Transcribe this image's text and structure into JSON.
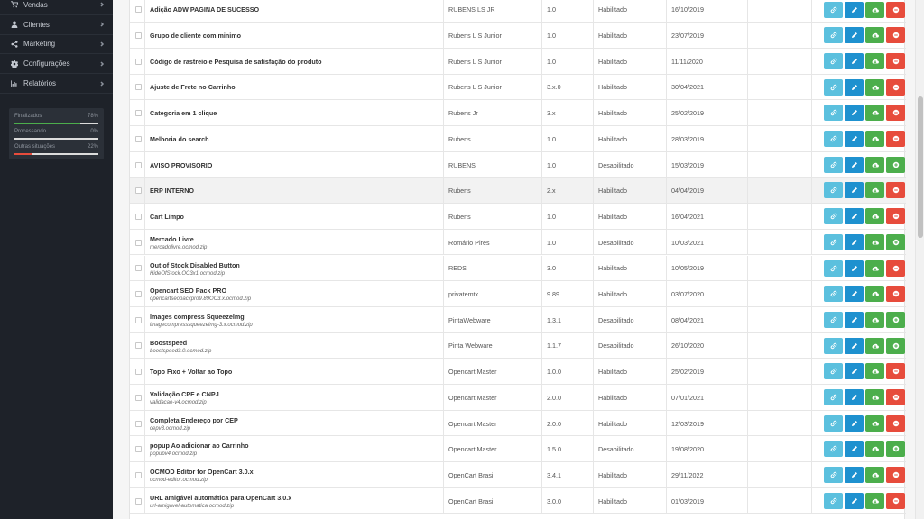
{
  "sidebar": {
    "items": [
      {
        "label": "Vendas",
        "icon": "shopping-cart-icon"
      },
      {
        "label": "Clientes",
        "icon": "user-icon"
      },
      {
        "label": "Marketing",
        "icon": "share-icon"
      },
      {
        "label": "Configurações",
        "icon": "gear-icon"
      },
      {
        "label": "Relatórios",
        "icon": "bar-chart-icon"
      }
    ],
    "stats": [
      {
        "label": "Finalizados",
        "value": "78%",
        "fraction": 0.78,
        "color": "#4cae4c"
      },
      {
        "label": "Processando",
        "value": "0%",
        "fraction": 0.0,
        "color": "#1e91cf"
      },
      {
        "label": "Outras situações",
        "value": "22%",
        "fraction": 0.22,
        "color": "#e74c3c"
      }
    ]
  },
  "colors": {
    "info": "#5bc0de",
    "primary": "#1e91cf",
    "success": "#4cae4c",
    "danger": "#e74c3c"
  },
  "modifications": [
    {
      "name": "Adição ADW PAGINA DE SUCESSO",
      "file": "",
      "author": "RUBENS LS JR",
      "version": "1.0",
      "status": "Habilitado",
      "date": "16/10/2019",
      "enabled": true,
      "highlighted": false
    },
    {
      "name": "Grupo de cliente com minimo",
      "file": "",
      "author": "Rubens L S Junior",
      "version": "1.0",
      "status": "Habilitado",
      "date": "23/07/2019",
      "enabled": true,
      "highlighted": false
    },
    {
      "name": "Código de rastreio e Pesquisa de satisfação do produto",
      "file": "",
      "author": "Rubens L S Junior",
      "version": "1.0",
      "status": "Habilitado",
      "date": "11/11/2020",
      "enabled": true,
      "highlighted": false
    },
    {
      "name": "Ajuste de Frete no Carrinho",
      "file": "",
      "author": "Rubens L S Junior",
      "version": "3.x.0",
      "status": "Habilitado",
      "date": "30/04/2021",
      "enabled": true,
      "highlighted": false
    },
    {
      "name": "Categoria em 1 clique",
      "file": "",
      "author": "Rubens Jr",
      "version": "3.x",
      "status": "Habilitado",
      "date": "25/02/2019",
      "enabled": true,
      "highlighted": false
    },
    {
      "name": "Melhoria do search",
      "file": "",
      "author": "Rubens",
      "version": "1.0",
      "status": "Habilitado",
      "date": "28/03/2019",
      "enabled": true,
      "highlighted": false
    },
    {
      "name": "AVISO PROVISORIO",
      "file": "",
      "author": "RUBENS",
      "version": "1.0",
      "status": "Desabilitado",
      "date": "15/03/2019",
      "enabled": false,
      "highlighted": false
    },
    {
      "name": "ERP INTERNO",
      "file": "",
      "author": "Rubens",
      "version": "2.x",
      "status": "Habilitado",
      "date": "04/04/2019",
      "enabled": true,
      "highlighted": true
    },
    {
      "name": "Cart Limpo",
      "file": "",
      "author": "Rubens",
      "version": "1.0",
      "status": "Habilitado",
      "date": "16/04/2021",
      "enabled": true,
      "highlighted": false
    },
    {
      "name": "Mercado Livre",
      "file": "mercadolivre.ocmod.zip",
      "author": "Romário Pires",
      "version": "1.0",
      "status": "Desabilitado",
      "date": "10/03/2021",
      "enabled": false,
      "highlighted": false
    },
    {
      "name": "Out of Stock Disabled Button",
      "file": "HideOfStock.OC3x1.ocmod.zip",
      "author": "REDS",
      "version": "3.0",
      "status": "Habilitado",
      "date": "10/05/2019",
      "enabled": true,
      "highlighted": false
    },
    {
      "name": "Opencart SEO Pack PRO",
      "file": "opencartseopackpro9.89OC3.x.ocmod.zip",
      "author": "privatemtx",
      "version": "9.89",
      "status": "Habilitado",
      "date": "03/07/2020",
      "enabled": true,
      "highlighted": false
    },
    {
      "name": "Images compress SqueezeImg",
      "file": "imagecompresssqueezeimg-3.x.ocmod.zip",
      "author": "PintaWebware",
      "version": "1.3.1",
      "status": "Desabilitado",
      "date": "08/04/2021",
      "enabled": false,
      "highlighted": false
    },
    {
      "name": "Boostspeed",
      "file": "boostspeed3.0.ocmod.zip",
      "author": "Pinta Webware",
      "version": "1.1.7",
      "status": "Desabilitado",
      "date": "26/10/2020",
      "enabled": false,
      "highlighted": false
    },
    {
      "name": "Topo Fixo + Voltar ao Topo",
      "file": "",
      "author": "Opencart Master",
      "version": "1.0.0",
      "status": "Habilitado",
      "date": "25/02/2019",
      "enabled": true,
      "highlighted": false
    },
    {
      "name": "Validação CPF e CNPJ",
      "file": "validacao-v4.ocmod.zip",
      "author": "Opencart Master",
      "version": "2.0.0",
      "status": "Habilitado",
      "date": "07/01/2021",
      "enabled": true,
      "highlighted": false
    },
    {
      "name": "Completa Endereço por CEP",
      "file": "cepv3.ocmod.zip",
      "author": "Opencart Master",
      "version": "2.0.0",
      "status": "Habilitado",
      "date": "12/03/2019",
      "enabled": true,
      "highlighted": false
    },
    {
      "name": "popup Ao adicionar ao Carrinho",
      "file": "popupv4.ocmod.zip",
      "author": "Opencart Master",
      "version": "1.5.0",
      "status": "Desabilitado",
      "date": "19/08/2020",
      "enabled": false,
      "highlighted": false
    },
    {
      "name": "OCMOD Editor for OpenCart 3.0.x",
      "file": "ocmod-editor.ocmod.zip",
      "author": "OpenCart Brasil",
      "version": "3.4.1",
      "status": "Habilitado",
      "date": "29/11/2022",
      "enabled": true,
      "highlighted": false
    },
    {
      "name": "URL amigável automática para OpenCart 3.0.x",
      "file": "url-amigavel-automatica.ocmod.zip",
      "author": "OpenCart Brasil",
      "version": "3.0.0",
      "status": "Habilitado",
      "date": "01/03/2019",
      "enabled": true,
      "highlighted": false
    }
  ]
}
